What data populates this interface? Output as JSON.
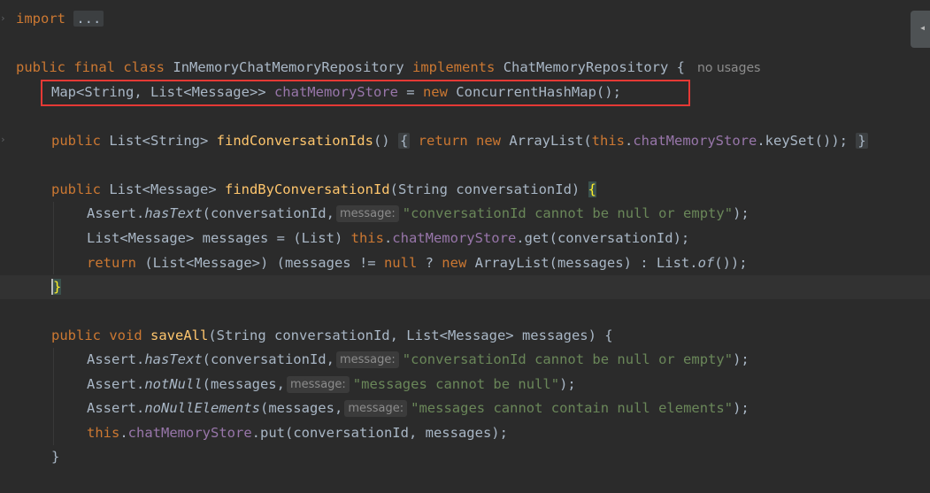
{
  "editor": {
    "line1": {
      "kw_import": "import",
      "fold": "..."
    },
    "class_decl": {
      "kw1": "public",
      "kw2": "final",
      "kw3": "class",
      "name": "InMemoryChatMemoryRepository",
      "kw4": "implements",
      "iface": "ChatMemoryRepository {",
      "usages": "no usages"
    },
    "field": {
      "type": "Map<String, List<Message>> ",
      "name": "chatMemoryStore",
      "eq": " = ",
      "kw_new": "new",
      "rest": " ConcurrentHashMap();"
    },
    "find_ids": {
      "kw_public": "public",
      "type": " List<String> ",
      "name": "findConversationIds",
      "paren": "()",
      "lbrace": "{",
      "kw_return": "return",
      "kw_new": "new",
      "mid": " ArrayList(",
      "kw_this": "this",
      "dot": ".",
      "fld": "chatMemoryStore",
      "tail": ".keySet());",
      "rbrace": "}"
    },
    "find_by": {
      "kw_public": "public",
      "type": " List<Message> ",
      "name": "findByConversationId",
      "params": "(String conversationId) ",
      "brace": "{"
    },
    "assert1": {
      "cls": "Assert.",
      "m": "hasText",
      "args": "(conversationId,",
      "hint": "message:",
      "str": "\"conversationId cannot be null or empty\"",
      "end": ");"
    },
    "get_line": {
      "a": "List<Message> messages = (List) ",
      "kw_this": "this",
      "dot": ".",
      "fld": "chatMemoryStore",
      "b": ".get(conversationId);"
    },
    "return_line": {
      "kw_return": "return",
      "a": " (List<Message>) (messages != ",
      "kw_null": "null",
      "b": " ? ",
      "kw_new": "new",
      "c": " ArrayList(messages) : List.",
      "of": "of",
      "d": "());"
    },
    "close_brace": "}",
    "save_all": {
      "kw_public": "public",
      "kw_void": "void",
      "name": "saveAll",
      "params": "(String conversationId, List<Message> messages) {"
    },
    "assert2": {
      "cls": "Assert.",
      "m": "hasText",
      "args": "(conversationId,",
      "hint": "message:",
      "str": "\"conversationId cannot be null or empty\"",
      "end": ");"
    },
    "assert3": {
      "cls": "Assert.",
      "m": "notNull",
      "args": "(messages,",
      "hint": "message:",
      "str": "\"messages cannot be null\"",
      "end": ");"
    },
    "assert4": {
      "cls": "Assert.",
      "m": "noNullElements",
      "args": "(messages,",
      "hint": "message:",
      "str": "\"messages cannot contain null elements\"",
      "end": ");"
    },
    "put_line": {
      "kw_this": "this",
      "dot": ".",
      "fld": "chatMemoryStore",
      "b": ".put(conversationId, messages);"
    },
    "close_brace2": "}"
  },
  "colors": {
    "background": "#2b2b2b",
    "keyword": "#cc7832",
    "function": "#ffc66d",
    "field": "#9876aa",
    "string": "#6a8759",
    "highlight_box": "#e53935"
  }
}
